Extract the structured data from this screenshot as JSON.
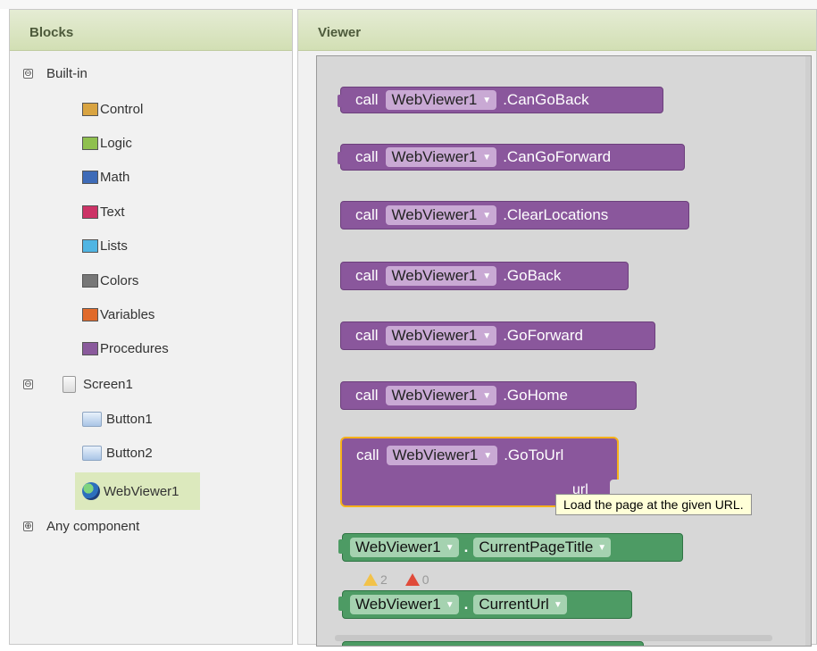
{
  "blocks_panel": {
    "title": "Blocks",
    "builtin": {
      "label": "Built-in",
      "toggle": "⊖",
      "items": [
        {
          "label": "Control",
          "color": "#d9a441"
        },
        {
          "label": "Logic",
          "color": "#8fc04e"
        },
        {
          "label": "Math",
          "color": "#3e6bb8"
        },
        {
          "label": "Text",
          "color": "#cc3366"
        },
        {
          "label": "Lists",
          "color": "#50b5e3"
        },
        {
          "label": "Colors",
          "color": "#777777"
        },
        {
          "label": "Variables",
          "color": "#e06a2b"
        },
        {
          "label": "Procedures",
          "color": "#8a5a9c"
        }
      ]
    },
    "screen": {
      "label": "Screen1",
      "toggle": "⊖",
      "children": [
        "Button1",
        "Button2",
        "WebViewer1"
      ]
    },
    "any_component": {
      "label": "Any component",
      "toggle": "⊕"
    }
  },
  "viewer_panel": {
    "title": "Viewer",
    "call_blocks": [
      {
        "keyword": "call",
        "component": "WebViewer1",
        "method": ".CanGoBack"
      },
      {
        "keyword": "call",
        "component": "WebViewer1",
        "method": ".CanGoForward"
      },
      {
        "keyword": "call",
        "component": "WebViewer1",
        "method": ".ClearLocations"
      },
      {
        "keyword": "call",
        "component": "WebViewer1",
        "method": ".GoBack"
      },
      {
        "keyword": "call",
        "component": "WebViewer1",
        "method": ".GoForward"
      },
      {
        "keyword": "call",
        "component": "WebViewer1",
        "method": ".GoHome"
      }
    ],
    "goto_block": {
      "keyword": "call",
      "component": "WebViewer1",
      "method": ".GoToUrl",
      "param": "url"
    },
    "tooltip": "Load the page at the given URL.",
    "getter_blocks": [
      {
        "component": "WebViewer1",
        "dot": ".",
        "property": "CurrentPageTitle"
      },
      {
        "component": "WebViewer1",
        "dot": ".",
        "property": "CurrentUrl"
      }
    ],
    "warnings": {
      "warning_count": "2",
      "error_count": "0"
    }
  },
  "colors": {
    "procedure_block": "#8a579c",
    "getter_block": "#4d9b64",
    "selection_highlight": "#f6b11a",
    "header_green": "#d2dfb4"
  }
}
